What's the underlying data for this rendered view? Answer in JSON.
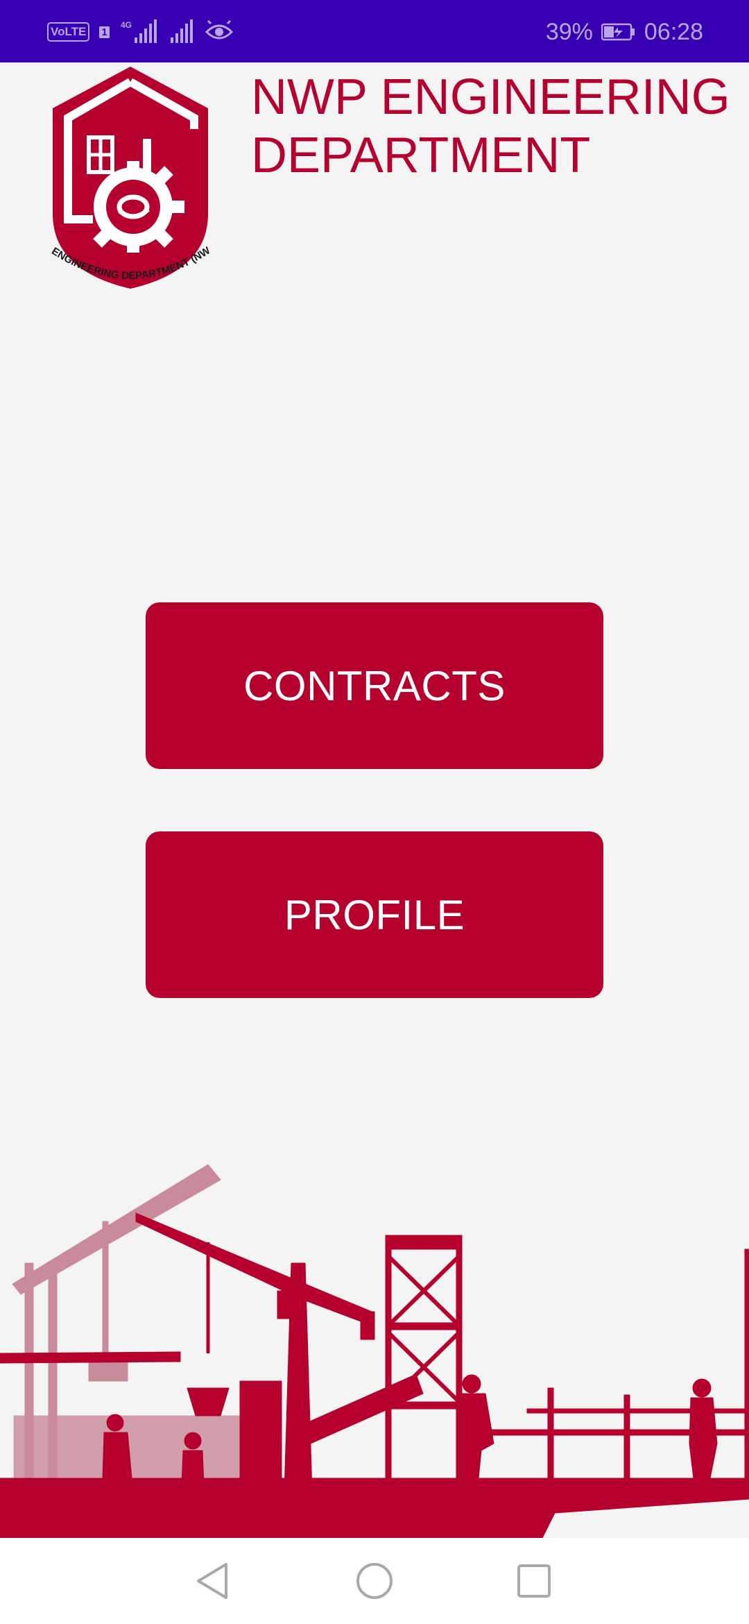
{
  "status_bar": {
    "network_badge": "VoLTE",
    "sim_number": "1",
    "network_type": "4G",
    "battery": "39%",
    "time": "06:28",
    "icons": [
      "volte-icon",
      "signal-icon",
      "signal-icon",
      "eye-icon",
      "battery-charging-icon"
    ]
  },
  "header": {
    "title_line1": "NWP ENGINEERING",
    "title_line2": "DEPARTMENT",
    "logo_text": "ENGINEERING DEPARTMENT (NWP)"
  },
  "actions": {
    "contracts_label": "CONTRACTS",
    "profile_label": "PROFILE"
  },
  "navigation": {
    "icons": [
      "back-icon",
      "home-icon",
      "recents-icon"
    ]
  },
  "colors": {
    "brand": "#b5002e",
    "status_bar": "#3700b3",
    "background": "#f5f4f5"
  }
}
